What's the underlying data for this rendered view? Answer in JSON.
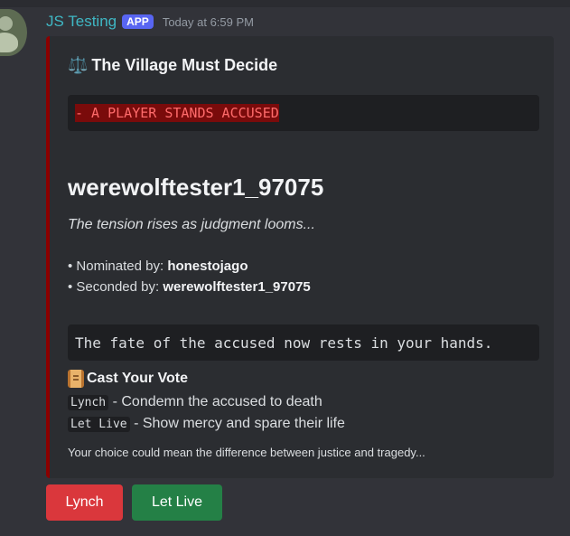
{
  "message": {
    "author": "JS Testing",
    "badge": "APP",
    "timestamp": "Today at 6:59 PM"
  },
  "embed": {
    "accent_color": "#8b0000",
    "title_icon": "⚖️",
    "title": "The Village Must Decide",
    "diff_line": "- A PLAYER STANDS ACCUSED",
    "player_name": "werewolftester1_97075",
    "tension": "The tension rises as judgment looms...",
    "nominated_label": "Nominated by: ",
    "nominated_by": "honestojago",
    "seconded_label": "Seconded by: ",
    "seconded_by": "werewolftester1_97075",
    "fate_text": "The fate of the accused now rests in your hands.",
    "vote_title": "Cast Your Vote",
    "options": [
      {
        "code": "Lynch",
        "description": "- Condemn the accused to death"
      },
      {
        "code": "Let Live",
        "description": "- Show mercy and spare their life"
      }
    ],
    "footer_note": "Your choice could mean the difference between justice and tragedy..."
  },
  "buttons": {
    "lynch": {
      "label": "Lynch",
      "color": "#da373c"
    },
    "let_live": {
      "label": "Let Live",
      "color": "#248046"
    }
  }
}
